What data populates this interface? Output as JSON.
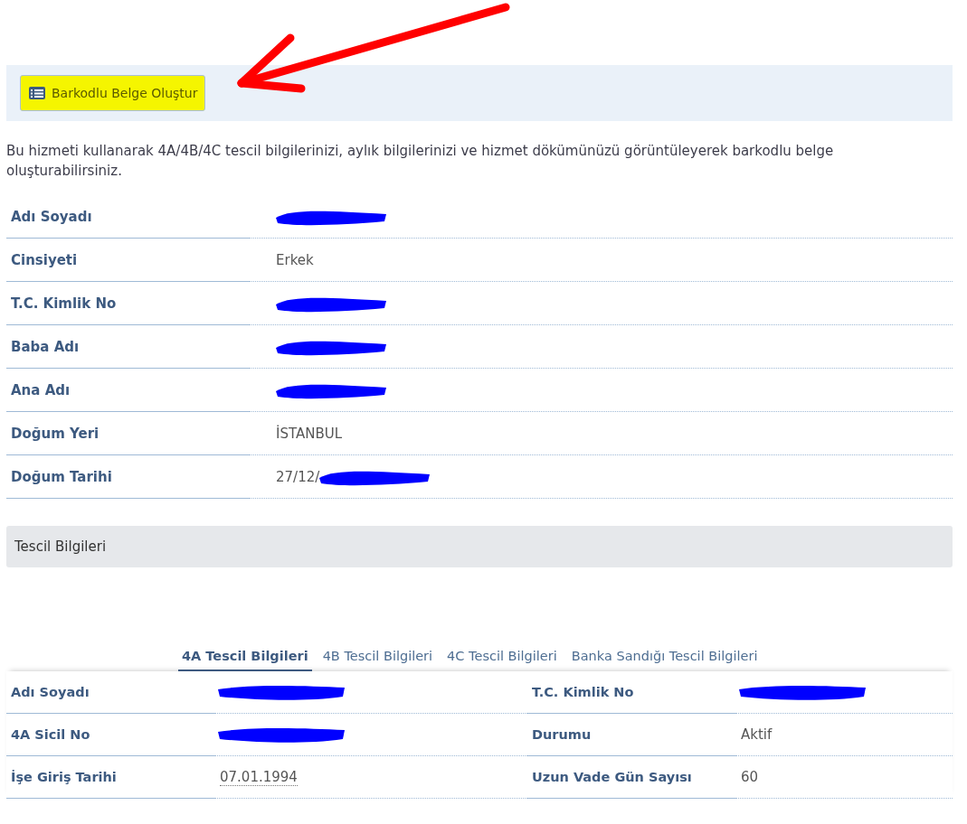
{
  "toolbar": {
    "button": {
      "label": "Barkodlu Belge Oluştur",
      "highlighted": true
    }
  },
  "description": "Bu hizmeti kullanarak 4A/4B/4C tescil bilgilerinizi, aylık bilgilerinizi ve hizmet dökümünüzü görüntüleyerek barkodlu belge oluşturabilirsiniz.",
  "personal": [
    {
      "label": "Adı Soyadı",
      "redacted": true
    },
    {
      "label": "Cinsiyeti",
      "value": "Erkek"
    },
    {
      "label": "T.C. Kimlik No",
      "redacted": true
    },
    {
      "label": "Baba Adı",
      "redacted": true
    },
    {
      "label": "Ana Adı",
      "redacted": true
    },
    {
      "label": "Doğum Yeri",
      "value": "İSTANBUL"
    },
    {
      "label": "Doğum Tarihi",
      "value": "27/12/",
      "redacted": true
    }
  ],
  "section_title": "Tescil Bilgileri",
  "tabs": [
    {
      "label": "4A Tescil Bilgileri",
      "selected": true
    },
    {
      "label": "4B Tescil Bilgileri",
      "selected": false
    },
    {
      "label": "4C Tescil Bilgileri",
      "selected": false
    },
    {
      "label": "Banka Sandığı Tescil Bilgileri",
      "selected": false
    }
  ],
  "registration": [
    {
      "label": "Adı Soyadı",
      "redacted": true
    },
    {
      "label": "T.C. Kimlik No",
      "redacted": true
    },
    {
      "label": "4A Sicil No",
      "redacted": true
    },
    {
      "label": "Durumu",
      "value": "Aktif"
    },
    {
      "label": "İşe Giriş Tarihi",
      "value": "07.01.1994"
    },
    {
      "label": "Uzun Vade Gün Sayısı",
      "value": "60"
    }
  ]
}
